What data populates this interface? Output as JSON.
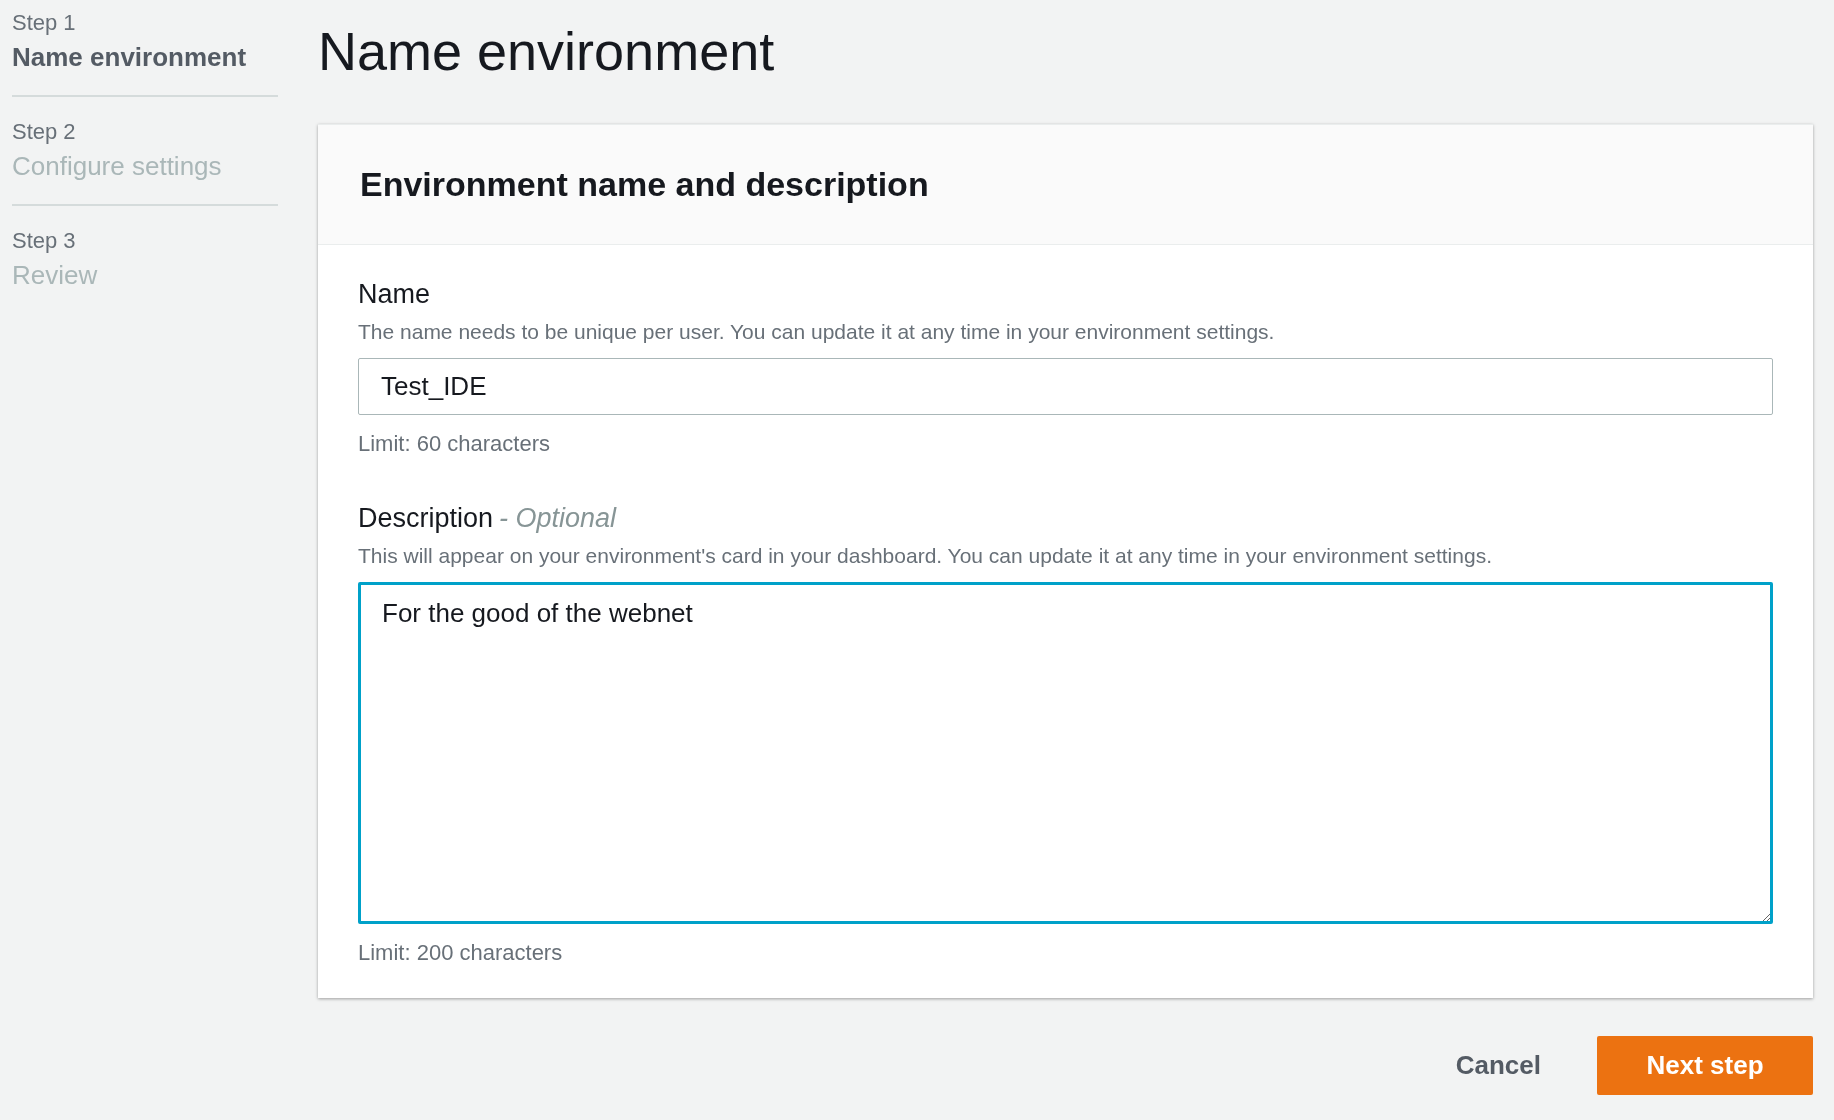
{
  "steps": [
    {
      "step": "Step 1",
      "label": "Name environment",
      "selected": true
    },
    {
      "step": "Step 2",
      "label": "Configure settings",
      "selected": false
    },
    {
      "step": "Step 3",
      "label": "Review",
      "selected": false
    }
  ],
  "page_title": "Name environment",
  "card": {
    "title": "Environment name and description",
    "fields": [
      {
        "kind": "input",
        "label": "Name",
        "hint": "The name needs to be unique per user. You can update it at any time in your environment settings.",
        "value": "Test_IDE",
        "limit": "Limit: 60 characters",
        "focused": false
      },
      {
        "kind": "textarea",
        "label": "Description",
        "optional": "- Optional",
        "hint": "This will appear on your environment's card in your dashboard. You can update it at any time in your environment settings.",
        "value": "For the good of the webnet",
        "limit": "Limit: 200 characters",
        "focused": true
      }
    ]
  },
  "buttons": [
    {
      "kind": "link",
      "label": "Cancel"
    },
    {
      "kind": "primary",
      "label": "Next step"
    }
  ]
}
